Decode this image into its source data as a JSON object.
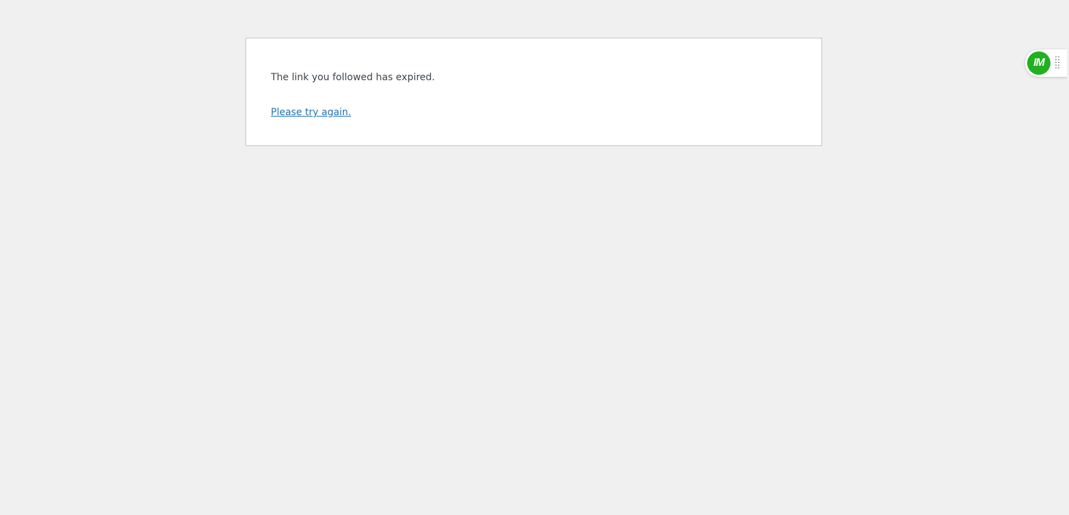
{
  "message": {
    "expired_text": "The link you followed has expired.",
    "retry_link_text": "Please try again."
  },
  "widget": {
    "logo_text": "IM",
    "logo_color": "#1fb11f",
    "handle_icon": "drag-handle-icon"
  },
  "colors": {
    "background": "#f0f0f1",
    "panel": "#ffffff",
    "border": "#c3c4c7",
    "text": "#3c434a",
    "link": "#2271b1"
  }
}
